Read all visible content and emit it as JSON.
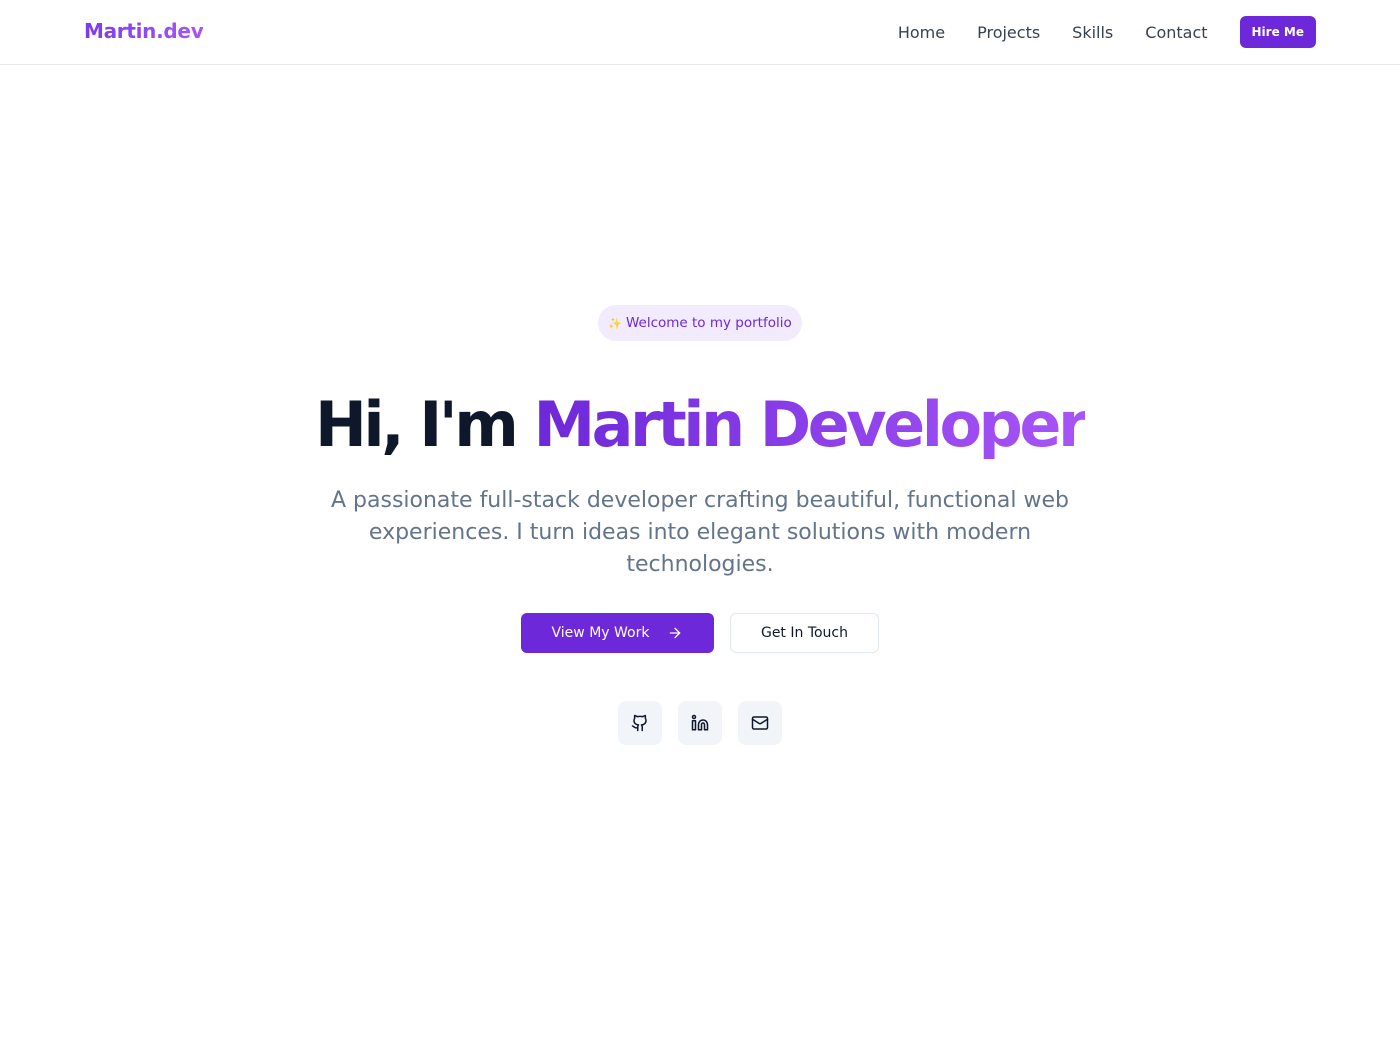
{
  "nav": {
    "brand": "Martin.dev",
    "links": [
      "Home",
      "Projects",
      "Skills",
      "Contact"
    ],
    "cta_label": "Hire Me"
  },
  "hero": {
    "badge_icon": "sparkle-icon",
    "badge_text": "Welcome to my portfolio",
    "headline_plain": "Hi, I'm",
    "headline_accent": "Martin Developer",
    "subtitle": "A passionate full-stack developer crafting beautiful, functional web experiences. I turn ideas into elegant solutions with modern technologies.",
    "primary_button": "View My Work",
    "primary_button_icon": "arrow-right-icon",
    "secondary_button": "Get In Touch",
    "social_icons": [
      "github-icon",
      "linkedin-icon",
      "mail-icon"
    ]
  },
  "colors": {
    "accent": "#6d28d9",
    "accent_light": "#a855f7",
    "badge_bg": "#f1ebfd",
    "text_dark": "#0f172a",
    "text_muted": "#64748b",
    "social_bg": "#f1f5f9"
  }
}
